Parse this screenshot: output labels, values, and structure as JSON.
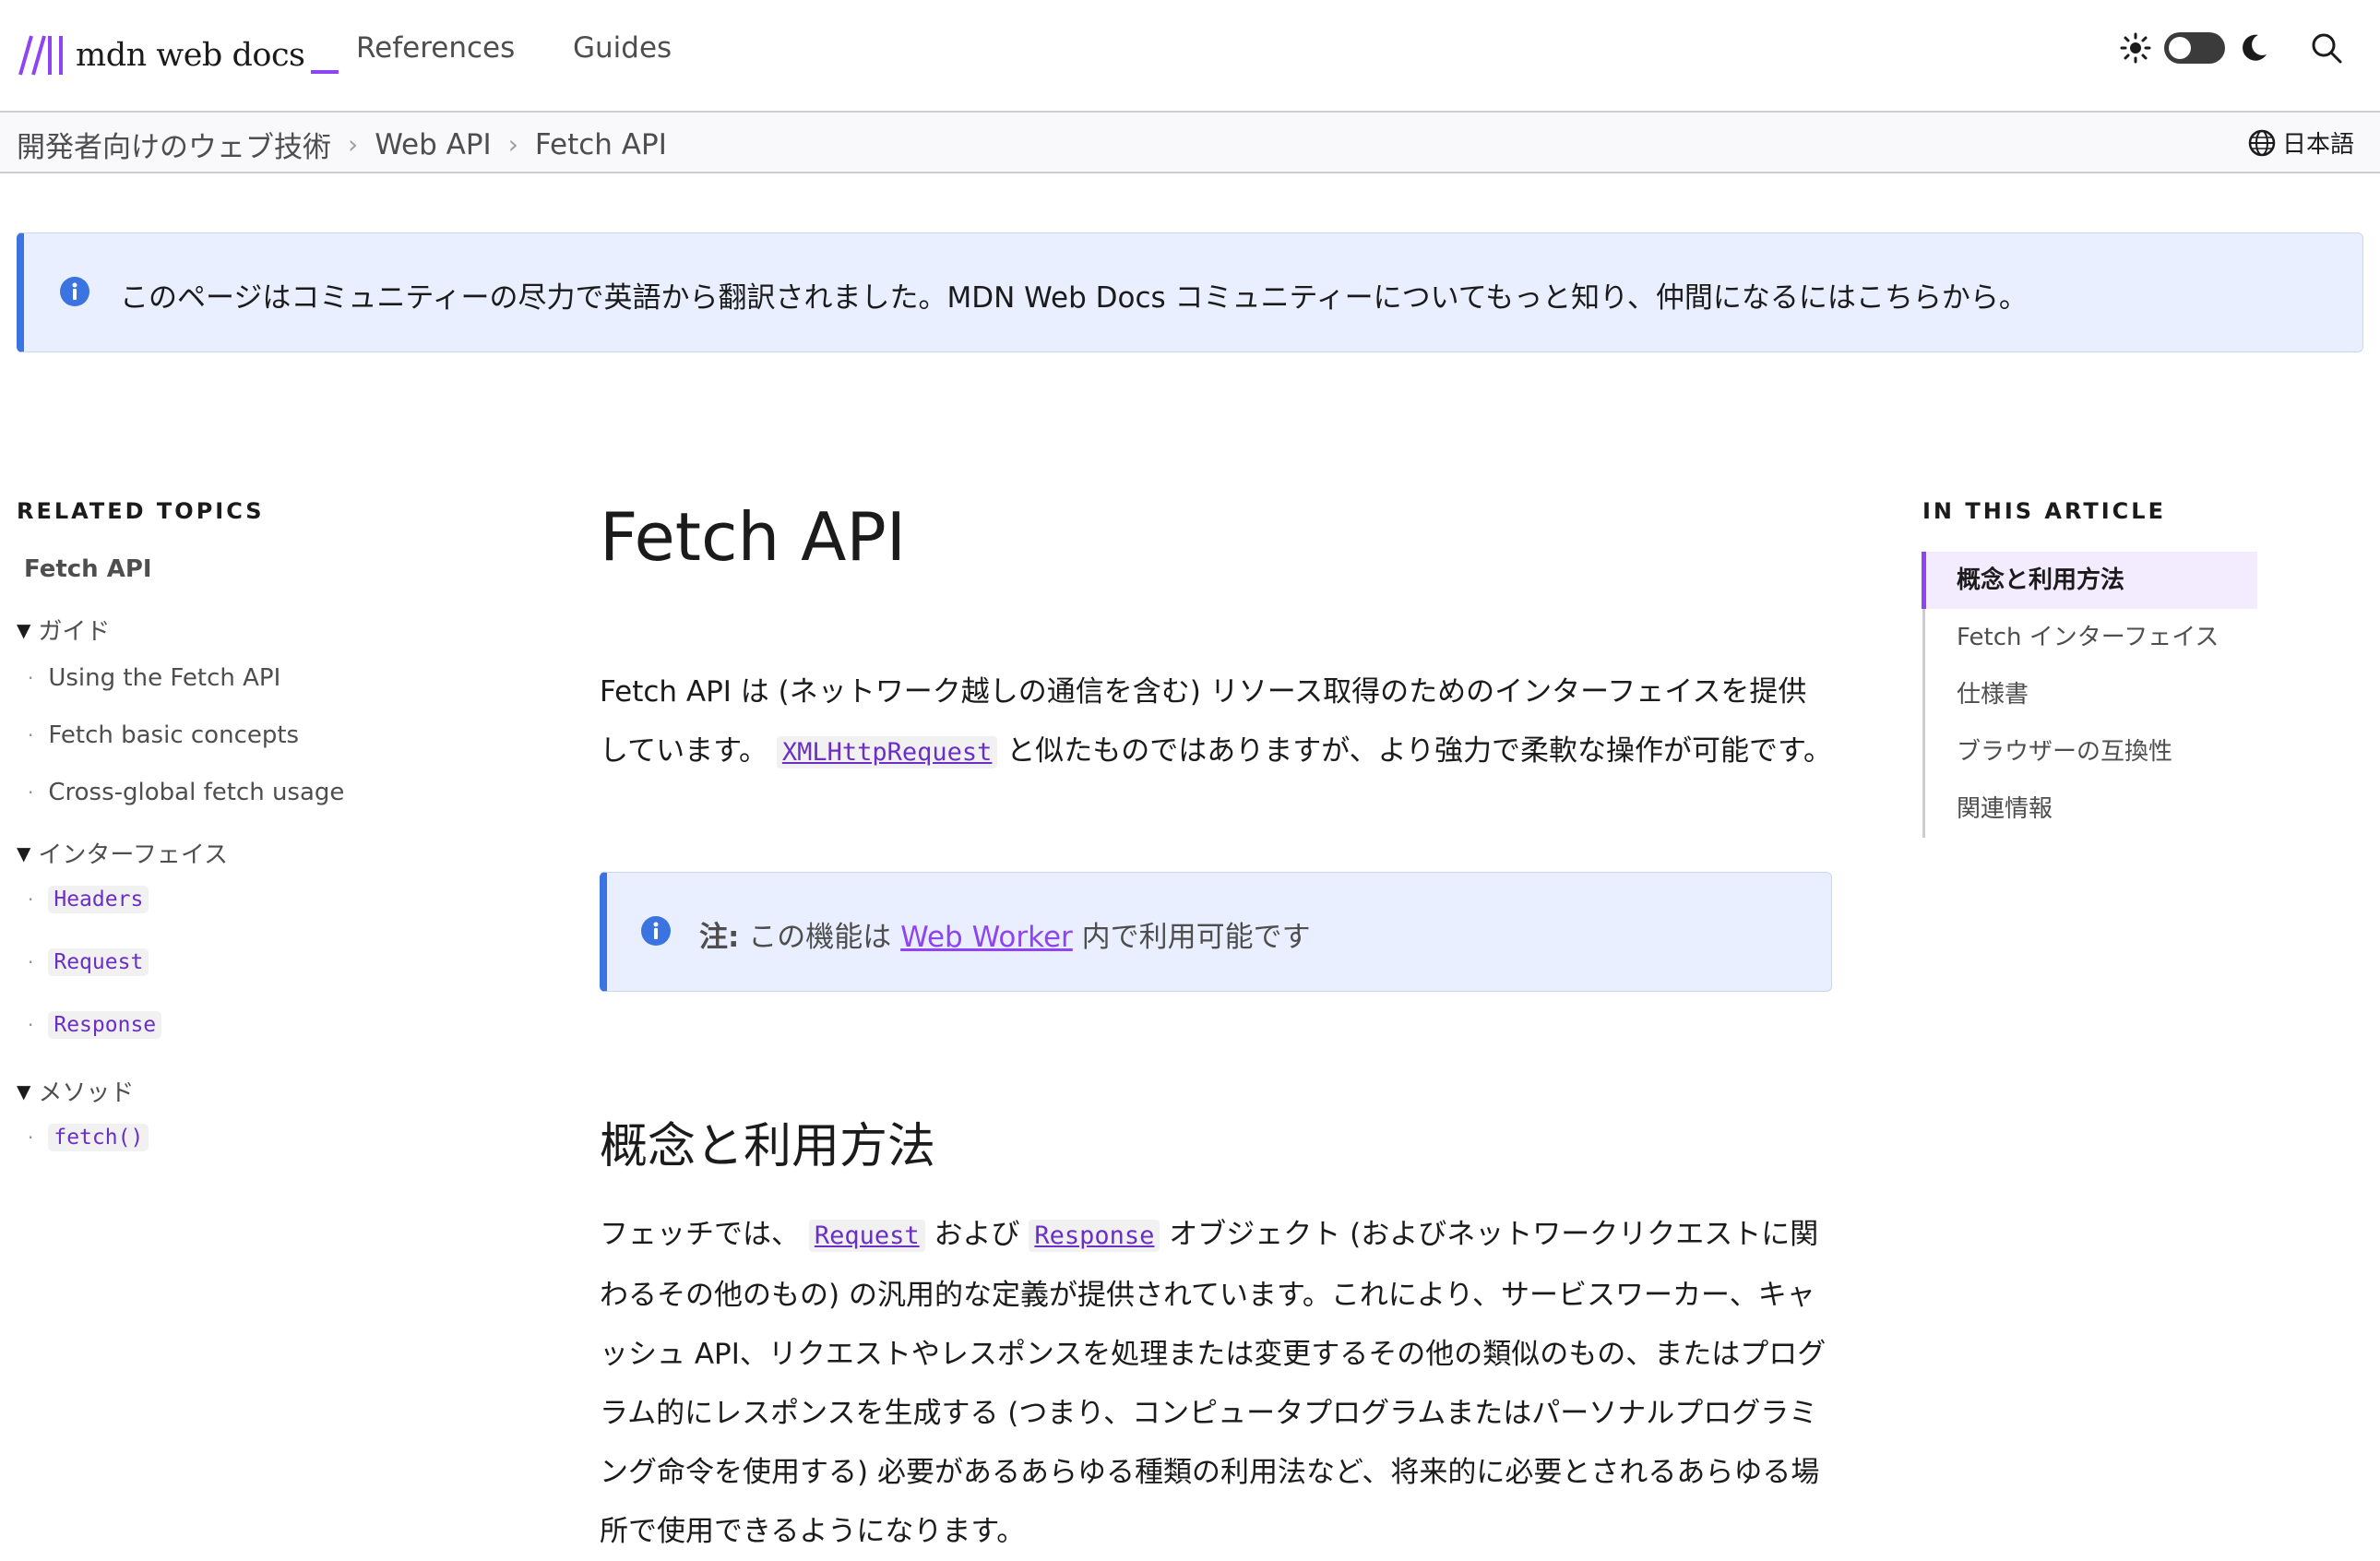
{
  "header": {
    "logo_text": "mdn web docs",
    "nav": [
      "References",
      "Guides"
    ],
    "icons": [
      "sun-icon",
      "theme-toggle",
      "moon-icon",
      "search-icon"
    ]
  },
  "breadcrumb": {
    "items": [
      "開発者向けのウェブ技術",
      "Web API",
      "Fetch API"
    ],
    "language": "日本語"
  },
  "notice": {
    "text": "このページはコミュニティーの尽力で英語から翻訳されました。MDN Web Docs コミュニティーについてもっと知り、仲間になるにはこちらから。"
  },
  "sidebar": {
    "heading": "RELATED TOPICS",
    "title": "Fetch API",
    "groups": [
      {
        "label": "ガイド",
        "items": [
          "Using the Fetch API",
          "Fetch basic concepts",
          "Cross-global fetch usage"
        ]
      },
      {
        "label": "インターフェイス",
        "items": [
          "Headers",
          "Request",
          "Response"
        ]
      },
      {
        "label": "メソッド",
        "items": [
          "fetch()"
        ]
      }
    ]
  },
  "main": {
    "title": "Fetch API",
    "intro": {
      "part1": "Fetch API は (ネットワーク越しの通信を含む) リソース取得のためのインターフェイスを提供しています。",
      "code": "XMLHttpRequest",
      "part2": "と似たものではありますが、より強力で柔軟な操作が可能です。"
    },
    "note": {
      "label": "注:",
      "before": "この機能は",
      "link": "Web Worker",
      "after": "内で利用可能です"
    },
    "section_title": "概念と利用方法",
    "section_para": {
      "part1": "フェッチでは、",
      "code1": "Request",
      "mid": "および",
      "code2": "Response",
      "part2": "オブジェクト (およびネットワークリクエストに関わるその他のもの) の汎用的な定義が提供されています。これにより、サービスワーカー、キャッシュ API、リクエストやレスポンスを処理または変更するその他の類似のもの、またはプログラム的にレスポンスを生成する (つまり、コンピュータプログラムまたはパーソナルプログラミング命令を使用する) 必要があるあらゆる種類の利用法など、将来的に必要とされるあらゆる場所で使用できるようになります。"
    }
  },
  "toc": {
    "heading": "IN THIS ARTICLE",
    "items": [
      "概念と利用方法",
      "Fetch インターフェイス",
      "仕様書",
      "ブラウザーの互換性",
      "関連情報"
    ]
  },
  "colors": {
    "accent": "#8e44f2",
    "info_blue": "#3b73e0",
    "notice_bg": "#e9efff"
  }
}
